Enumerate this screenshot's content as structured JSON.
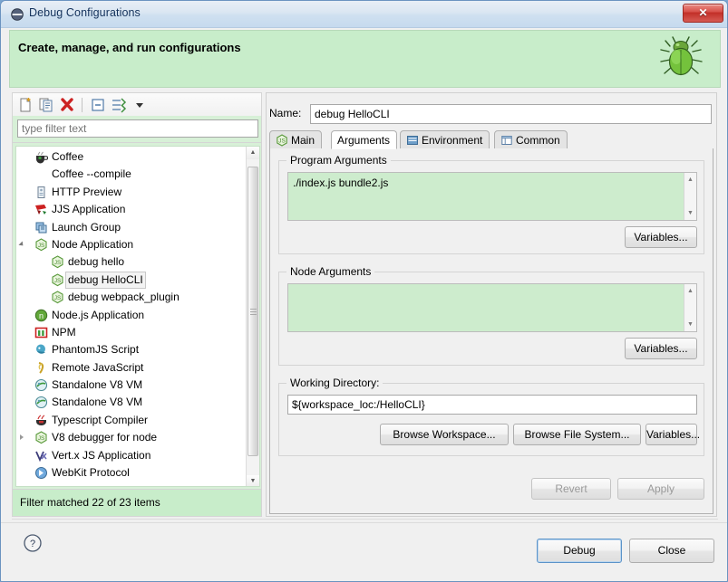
{
  "window": {
    "title": "Debug Configurations",
    "title_icon": "debug-icon",
    "close_label": "✕"
  },
  "banner": {
    "title": "Create, manage, and run configurations",
    "image": "green-bug-illustration",
    "bg_color": "#c8edca"
  },
  "left": {
    "toolbar": [
      {
        "name": "new-configuration-icon",
        "label": "New launch configuration"
      },
      {
        "name": "duplicate-configuration-icon",
        "label": "Duplicate"
      },
      {
        "name": "delete-configuration-icon",
        "label": "Delete"
      },
      {
        "name": "collapse-all-icon",
        "label": "Collapse All"
      },
      {
        "name": "filter-icon",
        "label": "Filter launch configurations"
      },
      {
        "name": "chevron-down-icon",
        "label": "View Menu"
      }
    ],
    "filter": {
      "placeholder": "type filter text",
      "value": ""
    },
    "tree": [
      {
        "label": "Coffee",
        "icon": "coffee-icon",
        "indent": 1,
        "twisty": "",
        "selected": false
      },
      {
        "label": "Coffee --compile",
        "icon": "none",
        "indent": 1,
        "twisty": "",
        "selected": false
      },
      {
        "label": "HTTP Preview",
        "icon": "http-preview-icon",
        "indent": 1,
        "twisty": "",
        "selected": false
      },
      {
        "label": "JJS Application",
        "icon": "jjs-icon",
        "indent": 1,
        "twisty": "",
        "selected": false
      },
      {
        "label": "Launch Group",
        "icon": "launch-group-icon",
        "indent": 1,
        "twisty": "",
        "selected": false
      },
      {
        "label": "Node Application",
        "icon": "node-js-icon",
        "indent": 1,
        "twisty": "open",
        "selected": false
      },
      {
        "label": "debug hello",
        "icon": "node-js-icon",
        "indent": 2,
        "twisty": "",
        "selected": false
      },
      {
        "label": "debug HelloCLI",
        "icon": "node-js-icon",
        "indent": 2,
        "twisty": "",
        "selected": true
      },
      {
        "label": "debug webpack_plugin",
        "icon": "node-js-icon",
        "indent": 2,
        "twisty": "",
        "selected": false
      },
      {
        "label": "Node.js Application",
        "icon": "nodejs-green-icon",
        "indent": 1,
        "twisty": "",
        "selected": false
      },
      {
        "label": "NPM",
        "icon": "npm-icon",
        "indent": 1,
        "twisty": "",
        "selected": false
      },
      {
        "label": "PhantomJS Script",
        "icon": "phantomjs-icon",
        "indent": 1,
        "twisty": "",
        "selected": false
      },
      {
        "label": "Remote JavaScript",
        "icon": "remote-js-icon",
        "indent": 1,
        "twisty": "",
        "selected": false
      },
      {
        "label": "Standalone V8 VM",
        "icon": "v8-icon",
        "indent": 1,
        "twisty": "",
        "selected": false
      },
      {
        "label": "Standalone V8 VM",
        "icon": "v8-icon",
        "indent": 1,
        "twisty": "",
        "selected": false
      },
      {
        "label": "Typescript Compiler",
        "icon": "typescript-icon",
        "indent": 1,
        "twisty": "",
        "selected": false
      },
      {
        "label": "V8 debugger for node",
        "icon": "node-js-icon",
        "indent": 1,
        "twisty": "closed",
        "selected": false
      },
      {
        "label": "Vert.x JS Application",
        "icon": "vertx-icon",
        "indent": 1,
        "twisty": "",
        "selected": false
      },
      {
        "label": "WebKit Protocol",
        "icon": "webkit-icon",
        "indent": 1,
        "twisty": "",
        "selected": false
      }
    ],
    "status": "Filter matched 22 of 23 items"
  },
  "right": {
    "name_label": "Name:",
    "name_value": "debug HelloCLI",
    "tabs": [
      {
        "label": "Main",
        "icon": "js-icon",
        "active": false
      },
      {
        "label": "Arguments",
        "icon": "none",
        "active": true
      },
      {
        "label": "Environment",
        "icon": "environment-icon",
        "active": false
      },
      {
        "label": "Common",
        "icon": "common-icon",
        "active": false
      }
    ],
    "program_arguments": {
      "group_title": "Program Arguments",
      "value": "./index.js bundle2.js",
      "variables_button": "Variables..."
    },
    "node_arguments": {
      "group_title": "Node Arguments",
      "value": "",
      "variables_button": "Variables..."
    },
    "working_directory": {
      "group_title": "Working Directory:",
      "value": "${workspace_loc:/HelloCLI}",
      "browse_workspace_button": "Browse Workspace...",
      "browse_filesystem_button": "Browse File System...",
      "variables_button": "Variables..."
    },
    "revert_button": "Revert",
    "apply_button": "Apply"
  },
  "footer": {
    "help_label": "?",
    "debug_button": "Debug",
    "close_button": "Close"
  }
}
